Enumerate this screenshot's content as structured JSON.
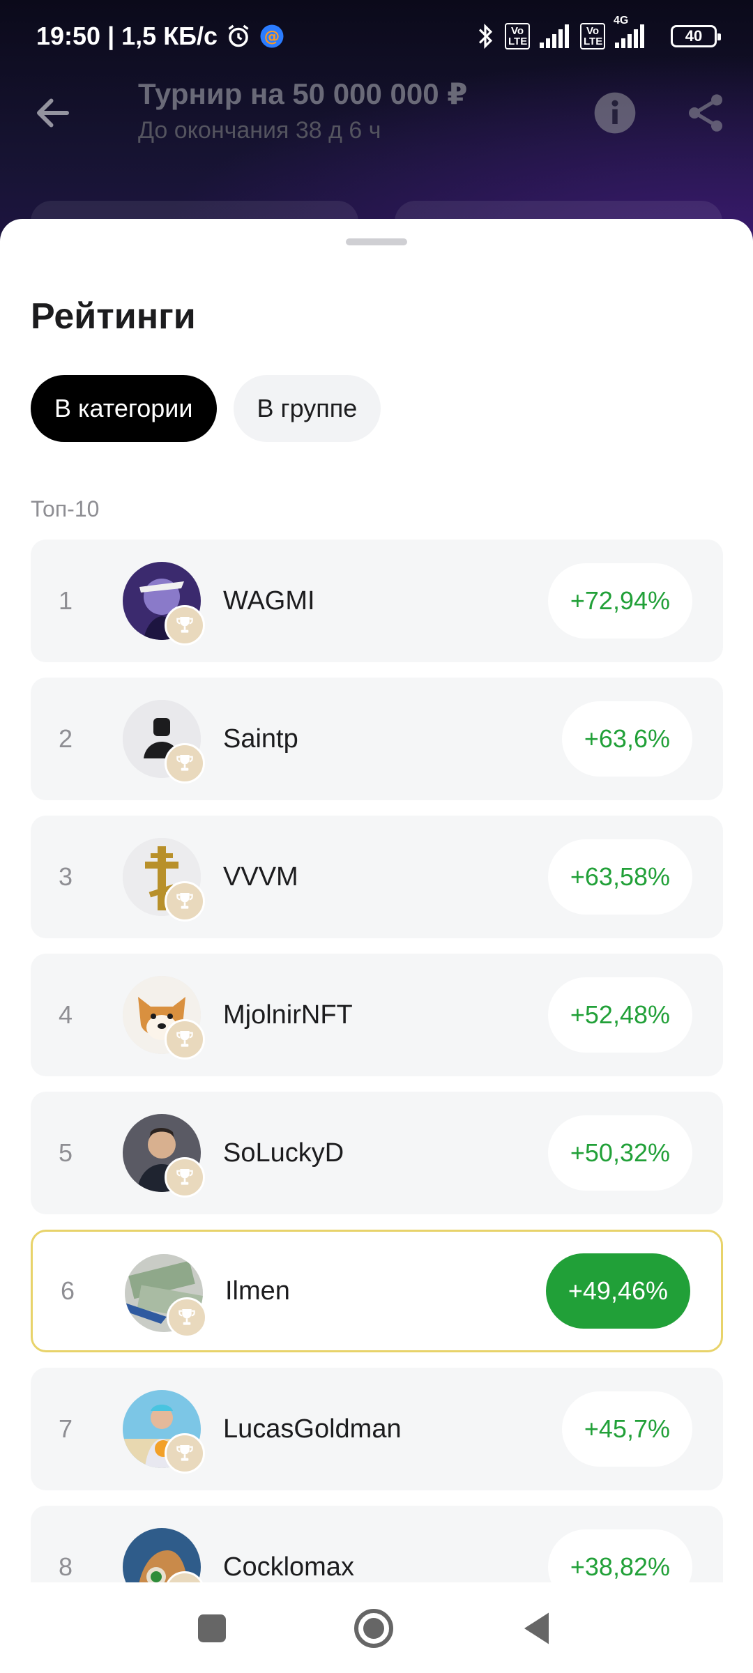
{
  "status_bar": {
    "time_speed": "19:50 | 1,5 КБ/с",
    "battery": "40",
    "vo_lte_1": "Vo\nLTE",
    "vo_lte_2": "Vo\nLTE",
    "network": "4G"
  },
  "header": {
    "title": "Турнир на 50 000 000 ₽",
    "subtitle": "До окончания 38 д 6 ч"
  },
  "sheet": {
    "title": "Рейтинги",
    "tabs": [
      {
        "label": "В категории",
        "active": true
      },
      {
        "label": "В группе",
        "active": false
      }
    ],
    "section_label": "Топ-10"
  },
  "rating": [
    {
      "rank": "1",
      "name": "WAGMI",
      "change": "+72,94%",
      "avatar": "anime-avatar",
      "highlight": false
    },
    {
      "rank": "2",
      "name": "Saintp",
      "change": "+63,6%",
      "avatar": "default-user-avatar",
      "highlight": false
    },
    {
      "rank": "3",
      "name": "VVVM",
      "change": "+63,58%",
      "avatar": "cross-avatar",
      "highlight": false
    },
    {
      "rank": "4",
      "name": "MjolnirNFT",
      "change": "+52,48%",
      "avatar": "dog-avatar",
      "highlight": false
    },
    {
      "rank": "5",
      "name": "SoLuckyD",
      "change": "+50,32%",
      "avatar": "man-avatar",
      "highlight": false
    },
    {
      "rank": "6",
      "name": "Ilmen",
      "change": "+49,46%",
      "avatar": "money-avatar",
      "highlight": true
    },
    {
      "rank": "7",
      "name": "LucasGoldman",
      "change": "+45,7%",
      "avatar": "beach-avatar",
      "highlight": false
    },
    {
      "rank": "8",
      "name": "Cocklomax",
      "change": "+38,82%",
      "avatar": "comic-avatar",
      "highlight": false
    }
  ],
  "colors": {
    "accent_green": "#21a038",
    "highlight_border": "#e8d36a",
    "tab_active": "#000000"
  }
}
